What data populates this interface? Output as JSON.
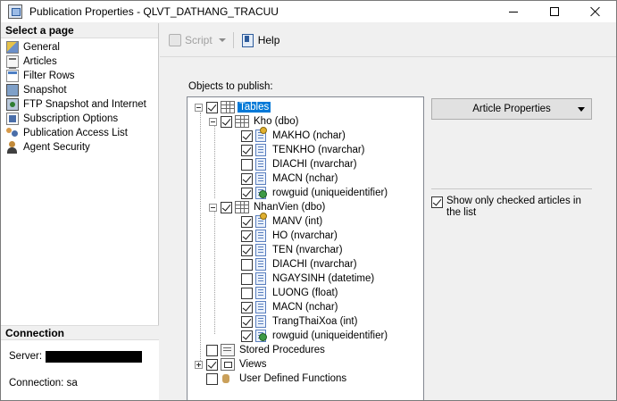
{
  "window": {
    "title": "Publication Properties - QLVT_DATHANG_TRACUU"
  },
  "left_panel": {
    "select_page_header": "Select a page",
    "pages": [
      {
        "label": "General",
        "icon": "general-icon"
      },
      {
        "label": "Articles",
        "icon": "articles-icon"
      },
      {
        "label": "Filter Rows",
        "icon": "filter-rows-icon"
      },
      {
        "label": "Snapshot",
        "icon": "snapshot-icon"
      },
      {
        "label": "FTP Snapshot and Internet",
        "icon": "ftp-icon"
      },
      {
        "label": "Subscription Options",
        "icon": "subscription-icon"
      },
      {
        "label": "Publication Access List",
        "icon": "access-list-icon"
      },
      {
        "label": "Agent Security",
        "icon": "agent-security-icon"
      }
    ],
    "connection_header": "Connection",
    "server_label": "Server:",
    "connection_label": "Connection: sa"
  },
  "toolbar": {
    "script_label": "Script",
    "help_label": "Help"
  },
  "main": {
    "objects_label": "Objects to publish:",
    "article_properties_label": "Article Properties",
    "show_only_checked_label": "Show only checked articles in the list",
    "show_only_checked": true
  },
  "tree": {
    "tables_label": "Tables",
    "kho": {
      "label": "Kho (dbo)",
      "columns": [
        {
          "label": "MAKHO (nchar)",
          "checked": true
        },
        {
          "label": "TENKHO (nvarchar)",
          "checked": true
        },
        {
          "label": "DIACHI (nvarchar)",
          "checked": false
        },
        {
          "label": "MACN (nchar)",
          "checked": true
        },
        {
          "label": "rowguid (uniqueidentifier)",
          "checked": true
        }
      ]
    },
    "nhanvien": {
      "label": "NhanVien (dbo)",
      "columns": [
        {
          "label": "MANV (int)",
          "checked": true
        },
        {
          "label": "HO (nvarchar)",
          "checked": true
        },
        {
          "label": "TEN (nvarchar)",
          "checked": true
        },
        {
          "label": "DIACHI (nvarchar)",
          "checked": false
        },
        {
          "label": "NGAYSINH (datetime)",
          "checked": false
        },
        {
          "label": "LUONG (float)",
          "checked": false
        },
        {
          "label": "MACN (nchar)",
          "checked": true
        },
        {
          "label": "TrangThaiXoa (int)",
          "checked": true
        },
        {
          "label": "rowguid (uniqueidentifier)",
          "checked": true
        }
      ]
    },
    "stored_procedures_label": "Stored Procedures",
    "views_label": "Views",
    "udf_label": "User Defined Functions"
  }
}
